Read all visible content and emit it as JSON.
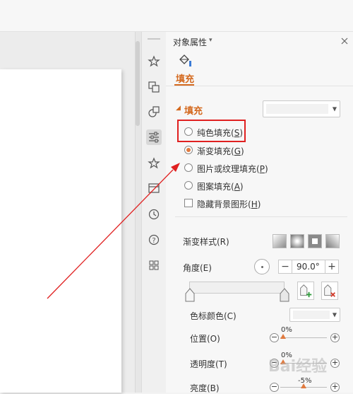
{
  "panel": {
    "title": "对象属性",
    "title_arrow": "▾",
    "close_icon": "close-icon",
    "tab_fill": "填充",
    "section_fill": "填充",
    "options": [
      {
        "label": "纯色填充(",
        "key": "S",
        "tail": ")",
        "selected": false
      },
      {
        "label": "渐变填充(",
        "key": "G",
        "tail": ")",
        "selected": true
      },
      {
        "label": "图片或纹理填充(",
        "key": "P",
        "tail": ")",
        "selected": false
      },
      {
        "label": "图案填充(",
        "key": "A",
        "tail": ")",
        "selected": false
      }
    ],
    "hide_bg_label": "隐藏背景图形(",
    "hide_bg_key": "H",
    "hide_bg_tail": ")",
    "gradient_style_label": "渐变样式(R)",
    "angle_label": "角度(E)",
    "angle_value": "90.0°",
    "minus": "−",
    "plus": "+",
    "stop_color_label": "色标颜色(C)",
    "position_label": "位置(O)",
    "position_value": "0%",
    "transparency_label": "透明度(T)",
    "transparency_value": "0%",
    "brightness_label": "亮度(B)",
    "brightness_value": "-5%"
  },
  "colors": {
    "accent": "#e07a3f",
    "tab_text": "#d4691e",
    "annotation_red": "#e02020"
  },
  "watermark": "Bai经验"
}
